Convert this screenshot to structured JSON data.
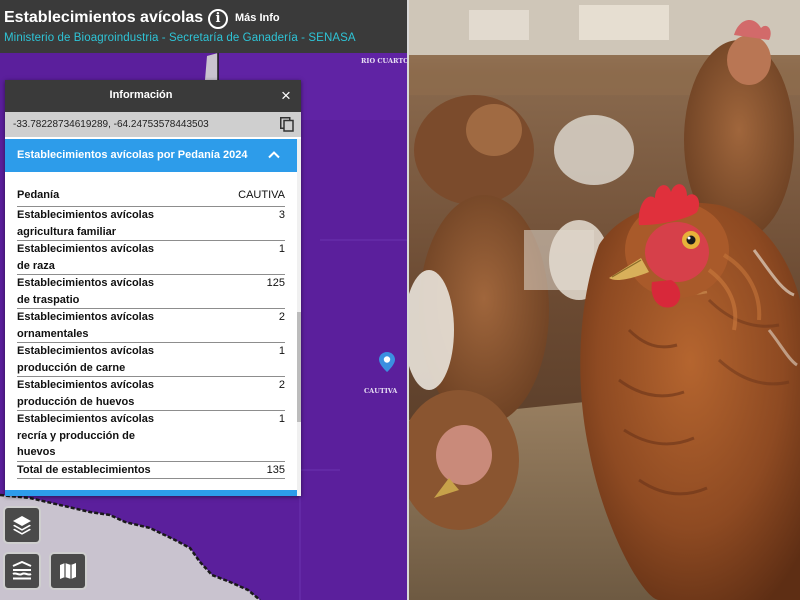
{
  "header": {
    "title": "Establecimientos avícolas",
    "more_info_label": "Más Info",
    "subtitle": "Ministerio de Bioagroindustria - Secretaría de Ganadería - SENASA",
    "info_icon": "info-circle-icon"
  },
  "map": {
    "labels": {
      "top": "RIO CUARTO",
      "pin": "CAUTIVA"
    },
    "colors": {
      "region": "#5b1f9c",
      "neighbor": "#c9c3cf"
    }
  },
  "panel": {
    "title": "Información",
    "close_label": "×",
    "coordinates": "-33.78228734619289, -64.24753578443503",
    "section_title": "Establecimientos avícolas por Pedanía 2024",
    "table": {
      "header": {
        "name": "Pedanía",
        "value": "CAUTIVA"
      },
      "rows": [
        {
          "name": "Establecimientos avícolas agricultura familiar",
          "value": "3"
        },
        {
          "name": "Establecimientos avícolas de raza",
          "value": "1"
        },
        {
          "name": "Establecimientos avícolas de traspatio",
          "value": "125"
        },
        {
          "name": "Establecimientos avícolas ornamentales",
          "value": "2"
        },
        {
          "name": "Establecimientos avícolas producción de carne",
          "value": "1"
        },
        {
          "name": "Establecimientos avícolas producción de huevos",
          "value": "2"
        },
        {
          "name": "Establecimientos avícolas recría y producción de huevos",
          "value": "1"
        },
        {
          "name": "Total de establecimientos",
          "value": "135"
        }
      ]
    },
    "accent_color": "#2d9cea"
  },
  "controls": {
    "layers_icon": "layers-icon",
    "legend_icon": "legend-icon",
    "basemap_icon": "map-icon"
  },
  "photo": {
    "subject": "hens"
  }
}
